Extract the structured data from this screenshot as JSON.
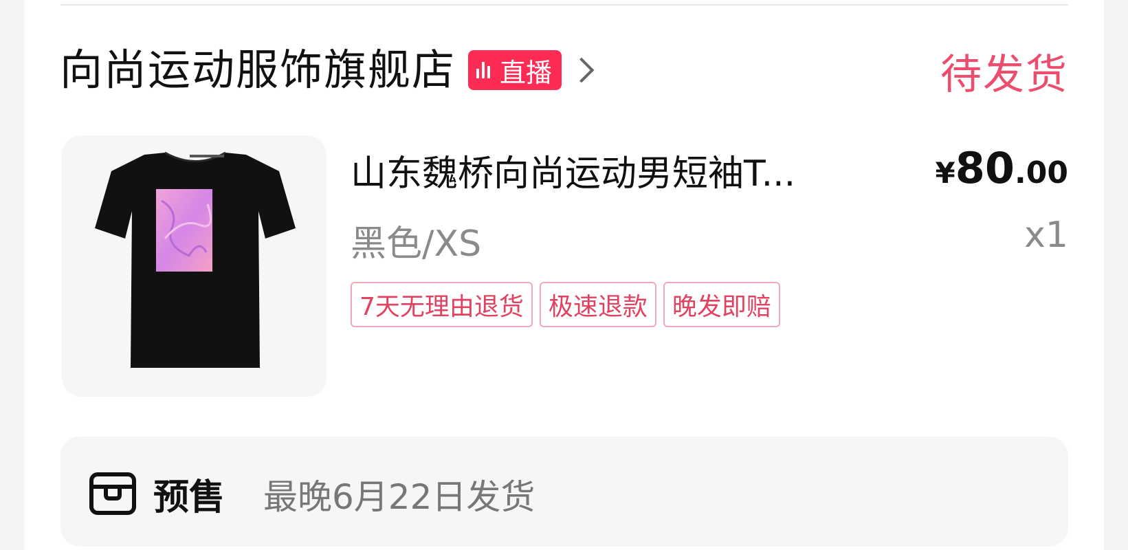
{
  "shop": {
    "name": "向尚运动服饰旗舰店",
    "live_label": "直播"
  },
  "order_status": "待发货",
  "product": {
    "title": "山东魏桥向尚运动男短袖T...",
    "price": {
      "currency": "¥",
      "integer": "80",
      "decimal": ".00"
    },
    "spec": "黑色/XS",
    "quantity": "x1",
    "tags": [
      "7天无理由退货",
      "极速退款",
      "晚发即赔"
    ],
    "image_icon": "black-tshirt-with-pink-print"
  },
  "presale": {
    "icon": "presale-box-icon",
    "label": "预售",
    "text": "最晚6月22日发货"
  },
  "colors": {
    "accent_pink": "#ec4d6d",
    "live_red": "#fe2c55",
    "tag_text": "#e0425f"
  }
}
